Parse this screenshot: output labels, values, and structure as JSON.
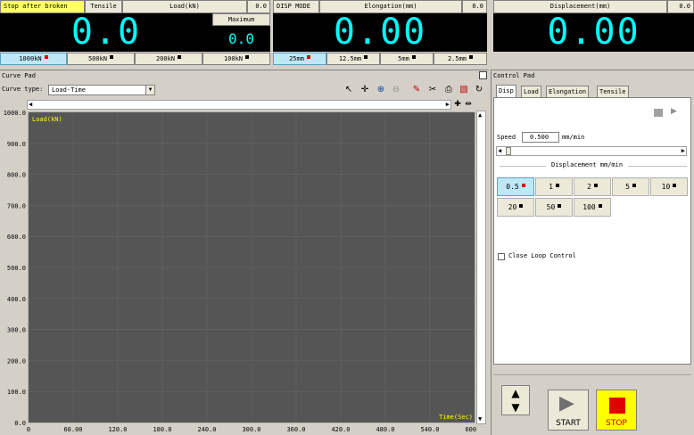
{
  "top": {
    "mode_label": "Stop after broken",
    "test_type": "Tensile",
    "load_title": "Load(kN)",
    "load_small_value": "0.0",
    "load_value": "0.0",
    "maximum_label": "Maximum",
    "maximum_value": "0.0",
    "load_ranges": [
      "1000kN",
      "500kN",
      "200kN",
      "100kN"
    ],
    "disp_mode": "DISP MODE",
    "elong_title": "Elongation(mm)",
    "elong_small_value": "0.0",
    "elong_value": "0.00",
    "elong_ranges": [
      "25mm",
      "12.5mm",
      "5mm",
      "2.5mm"
    ],
    "disp_title": "Displacement(mm)",
    "disp_small_value": "0.0",
    "disp_value": "0.00"
  },
  "curve_pad": {
    "title": "Curve Pad",
    "curve_type_label": "Curve type:",
    "curve_type_value": "Load-Time"
  },
  "chart_data": {
    "type": "line",
    "ylabel": "Load(kN)",
    "xlabel": "Time(Sec)",
    "y_ticks": [
      "1000.0",
      "900.0",
      "800.0",
      "700.0",
      "600.0",
      "500.0",
      "400.0",
      "300.0",
      "200.0",
      "100.0",
      "0.0"
    ],
    "x_ticks": [
      "0",
      "60.00",
      "120.0",
      "180.0",
      "240.0",
      "300.0",
      "360.0",
      "420.0",
      "480.0",
      "540.0",
      "600.0"
    ],
    "ylim": [
      0,
      1000
    ],
    "xlim": [
      0,
      600
    ],
    "series": [],
    "grid": true
  },
  "control_pad": {
    "title": "Control Pad",
    "tabs": [
      "Disp",
      "Load",
      "Elongation",
      "Tensile"
    ],
    "speed_label": "Speed",
    "speed_value": "0.500",
    "speed_unit": "mm/min",
    "displacement_title": "Displacement mm/min",
    "speeds": [
      "0.5",
      "1",
      "2",
      "5",
      "10",
      "20",
      "50",
      "100"
    ],
    "close_loop_label": "Close Loop Control",
    "start_label": "START",
    "stop_label": "STOP"
  },
  "colors": {
    "display_bg": "#000000",
    "display_fg": "#00ffff",
    "chart_bg": "#555555",
    "chart_label": "#ffff00",
    "stop_bg": "#ffff00",
    "stop_icon": "#e00000"
  }
}
